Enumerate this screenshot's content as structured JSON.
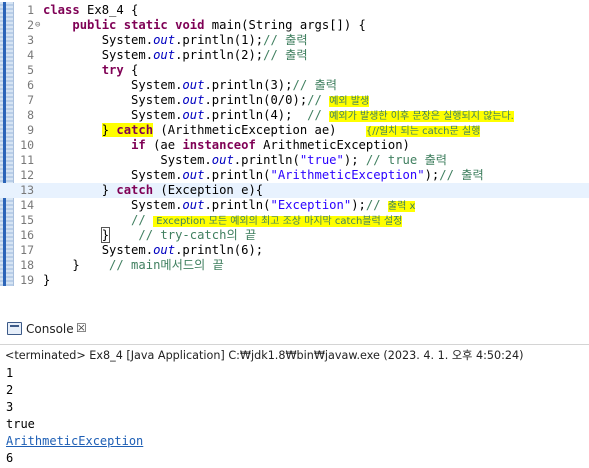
{
  "editor": {
    "lines": [
      {
        "n": "1",
        "fold": ""
      },
      {
        "n": "2",
        "fold": "⊖"
      },
      {
        "n": "3",
        "fold": ""
      },
      {
        "n": "4",
        "fold": ""
      },
      {
        "n": "5",
        "fold": ""
      },
      {
        "n": "6",
        "fold": ""
      },
      {
        "n": "7",
        "fold": ""
      },
      {
        "n": "8",
        "fold": ""
      },
      {
        "n": "9",
        "fold": ""
      },
      {
        "n": "10",
        "fold": ""
      },
      {
        "n": "11",
        "fold": ""
      },
      {
        "n": "12",
        "fold": ""
      },
      {
        "n": "13",
        "fold": ""
      },
      {
        "n": "14",
        "fold": ""
      },
      {
        "n": "15",
        "fold": ""
      },
      {
        "n": "16",
        "fold": ""
      },
      {
        "n": "17",
        "fold": ""
      },
      {
        "n": "18",
        "fold": ""
      },
      {
        "n": "19",
        "fold": ""
      }
    ],
    "code": {
      "l1_a": "class",
      "l1_b": " Ex8_4 {",
      "l2_a": "    ",
      "l2_kw1": "public",
      "l2_kw2": "static",
      "l2_kw3": "void",
      "l2_b": " main(String args[]) {",
      "l3_a": "        System.",
      "l3_f": "out",
      "l3_b": ".println(1);",
      "l3_c": "// 출력",
      "l4_a": "        System.",
      "l4_f": "out",
      "l4_b": ".println(2);",
      "l4_c": "// 출력",
      "l5_kw": "try",
      "l5_b": " {",
      "l6_a": "            System.",
      "l6_f": "out",
      "l6_b": ".println(3);",
      "l6_c": "// 출력",
      "l7_a": "            System.",
      "l7_f": "out",
      "l7_b": ".println(0/0);",
      "l7_c1": "// ",
      "l7_c2": "예외 발생",
      "l8_a": "            System.",
      "l8_f": "out",
      "l8_b": ".println(4);  ",
      "l8_c1": "// ",
      "l8_c2": "예외가 발생한 이후 문장은 실행되지 않는다.",
      "l9_brace": "}",
      "l9_kw": "catch",
      "l9_b": " (ArithmeticException ae)    ",
      "l9_c": "{//일치 되는 catch문 실행",
      "l10_kw1": "if",
      "l10_b": " (ae ",
      "l10_kw2": "instanceof",
      "l10_c": " ArithmeticException)",
      "l11_a": "                System.",
      "l11_f": "out",
      "l11_b": ".println(",
      "l11_s": "\"true\"",
      "l11_c": "); ",
      "l11_cm": "// true 출력",
      "l12_a": "            System.",
      "l12_f": "out",
      "l12_b": ".println(",
      "l12_s": "\"ArithmeticException\"",
      "l12_c": ");",
      "l12_cm": "// 출력",
      "l13_a": "        } ",
      "l13_kw": "catch",
      "l13_b": " (Exception e){",
      "l14_a": "            System.",
      "l14_f": "out",
      "l14_b": ".println(",
      "l14_s": "\"Exception\"",
      "l14_c": ");",
      "l14_cm1": "// ",
      "l14_cm2": "출력 x",
      "l15_c1": "            // ",
      "l15_c2": " Exception 모든 예외의 최고 조상 마지막 catch블럭 설정",
      "l16_brace": "}",
      "l16_c": "    // try-catch의 끝",
      "l17_a": "        System.",
      "l17_f": "out",
      "l17_b": ".println(6);",
      "l18_a": "    }    ",
      "l18_c": "// main메서드의 끝",
      "l19_a": "}"
    }
  },
  "console": {
    "tab_label": "Console",
    "close_glyph": "☒",
    "terminated": "<terminated> Ex8_4 [Java Application] C:₩jdk1.8₩bin₩javaw.exe (2023. 4. 1. 오후 4:50:24)",
    "output": [
      "1",
      "2",
      "3",
      "true",
      "ArithmeticException",
      "6"
    ]
  }
}
